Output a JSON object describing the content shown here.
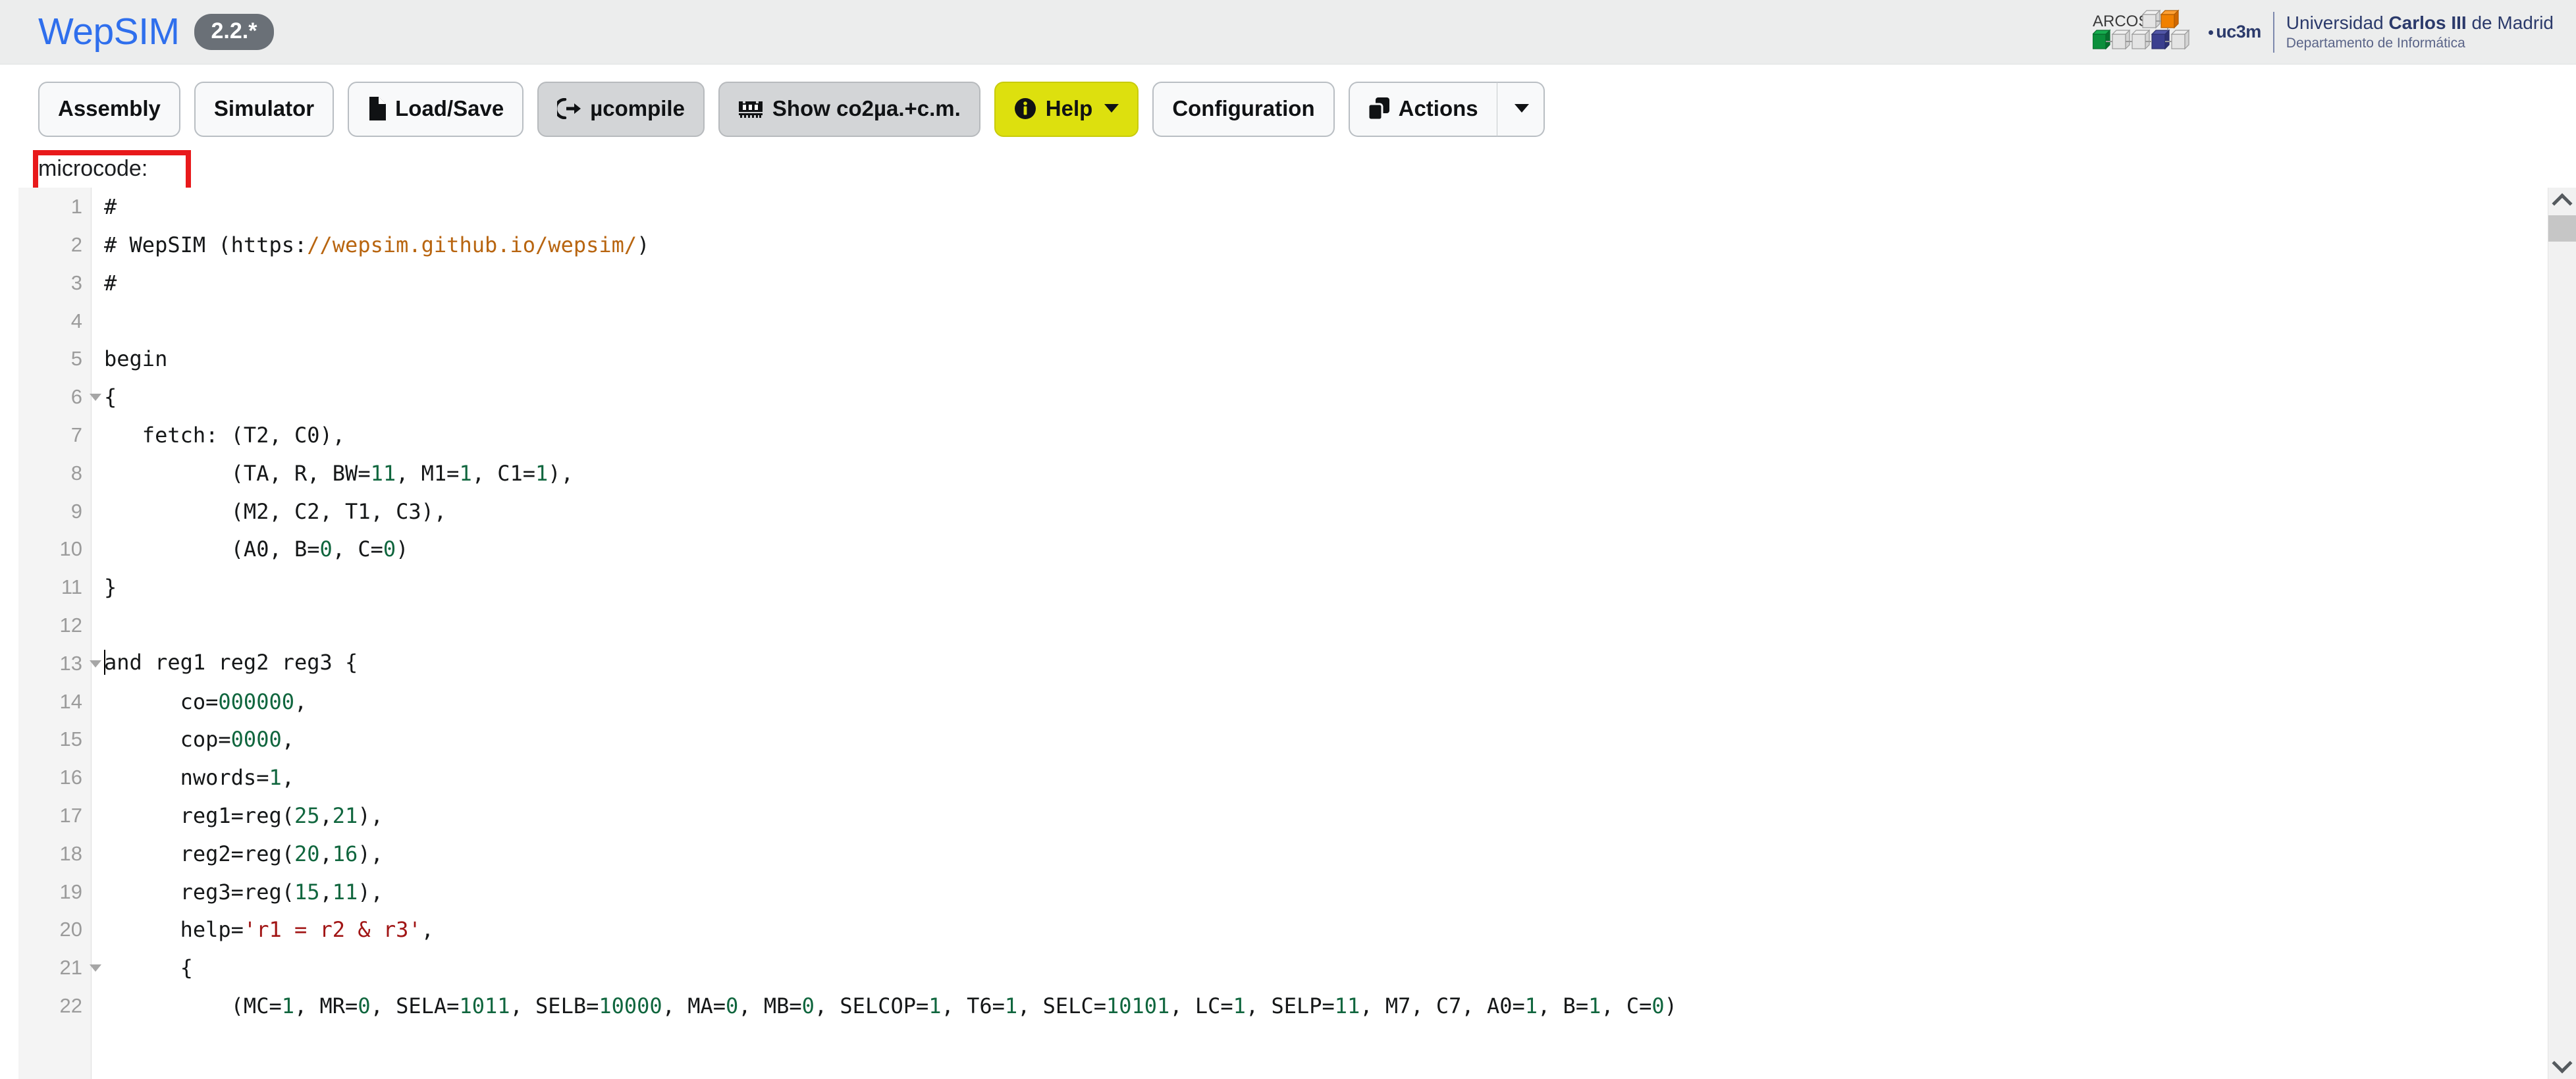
{
  "header": {
    "app_name": "WepSIM",
    "version_badge": "2.2.*",
    "logo": {
      "arcos_label": "ARCOS",
      "uc3m_word": "uc3m",
      "university_prefix": "Universidad ",
      "university_bold": "Carlos III",
      "university_suffix": " de Madrid",
      "department": "Departamento de Informática"
    },
    "colors": {
      "brand_blue": "#2f6fed",
      "badge_grey": "#6a7077",
      "uc3m_navy": "#2b3a6b",
      "arcos_orange": "#f08000",
      "arcos_green": "#0b8f3c",
      "arcos_navy": "#3b3f8f",
      "arcos_grey": "#cfcfcf"
    }
  },
  "toolbar": {
    "assembly_label": "Assembly",
    "simulator_label": "Simulator",
    "loadsave_label": "Load/Save",
    "ucompile_label": "µcompile",
    "show_co2_label": "Show co2µa.+c.m.",
    "help_label": "Help",
    "configuration_label": "Configuration",
    "actions_label": "Actions",
    "active_button": "Assembly",
    "highlight_color": "#e8191b",
    "help_color": "#dde00e"
  },
  "editor": {
    "section_label": "microcode:",
    "lines": [
      {
        "n": "1",
        "fold": false,
        "html": "#"
      },
      {
        "n": "2",
        "fold": false,
        "html": "# WepSIM (https:<span class=\"url\">//wepsim.github.io/wepsim/</span>)"
      },
      {
        "n": "3",
        "fold": false,
        "html": "#"
      },
      {
        "n": "4",
        "fold": false,
        "html": ""
      },
      {
        "n": "5",
        "fold": false,
        "html": "begin"
      },
      {
        "n": "6",
        "fold": true,
        "html": "{"
      },
      {
        "n": "7",
        "fold": false,
        "html": "   fetch: (T2, C0),"
      },
      {
        "n": "8",
        "fold": false,
        "html": "          (TA, R, BW=<span class=\"num\">11</span>, M1=<span class=\"num\">1</span>, C1=<span class=\"num\">1</span>),"
      },
      {
        "n": "9",
        "fold": false,
        "html": "          (M2, C2, T1, C3),"
      },
      {
        "n": "10",
        "fold": false,
        "html": "          (A0, B=<span class=\"num\">0</span>, C=<span class=\"num\">0</span>)"
      },
      {
        "n": "11",
        "fold": false,
        "html": "}"
      },
      {
        "n": "12",
        "fold": false,
        "html": ""
      },
      {
        "n": "13",
        "fold": true,
        "html": "<span class=\"caret-bar\"></span>and reg1 reg2 reg3 {"
      },
      {
        "n": "14",
        "fold": false,
        "html": "      co=<span class=\"num\">000000</span>,"
      },
      {
        "n": "15",
        "fold": false,
        "html": "      cop=<span class=\"num\">0000</span>,"
      },
      {
        "n": "16",
        "fold": false,
        "html": "      nwords=<span class=\"num\">1</span>,"
      },
      {
        "n": "17",
        "fold": false,
        "html": "      reg1=reg(<span class=\"num\">25</span>,<span class=\"num\">21</span>),"
      },
      {
        "n": "18",
        "fold": false,
        "html": "      reg2=reg(<span class=\"num\">20</span>,<span class=\"num\">16</span>),"
      },
      {
        "n": "19",
        "fold": false,
        "html": "      reg3=reg(<span class=\"num\">15</span>,<span class=\"num\">11</span>),"
      },
      {
        "n": "20",
        "fold": false,
        "html": "      help=<span class=\"str\">'r1 = r2 &amp; r3'</span>,"
      },
      {
        "n": "21",
        "fold": true,
        "html": "      {"
      },
      {
        "n": "22",
        "fold": false,
        "html": "          (MC=<span class=\"num\">1</span>, MR=<span class=\"num\">0</span>, SELA=<span class=\"num\">1011</span>, SELB=<span class=\"num\">10000</span>, MA=<span class=\"num\">0</span>, MB=<span class=\"num\">0</span>, SELCOP=<span class=\"num\">1</span>, T6=<span class=\"num\">1</span>, SELC=<span class=\"num\">10101</span>, LC=<span class=\"num\">1</span>, SELP=<span class=\"num\">11</span>, M7, C7, A0=<span class=\"num\">1</span>, B=<span class=\"num\">1</span>, C=<span class=\"num\">0</span>)"
      }
    ],
    "syntax_colors": {
      "number": "#10663e",
      "string": "#a11515",
      "url": "#b86510",
      "text": "#151718",
      "line_number": "#9b9b9b"
    }
  },
  "scrollbar": {
    "up_arrow": "chevron-up",
    "down_arrow": "chevron-down",
    "thumb_position_pct": 3
  }
}
